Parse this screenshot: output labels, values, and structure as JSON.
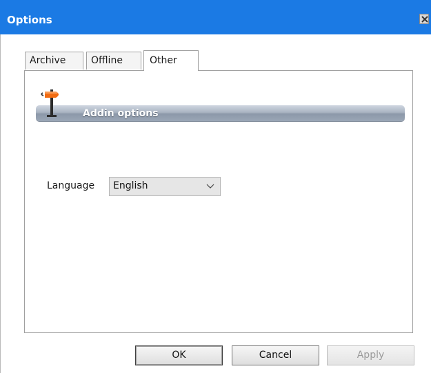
{
  "window": {
    "title": "Options"
  },
  "tabs": [
    {
      "label": "Archive"
    },
    {
      "label": "Offline"
    },
    {
      "label": "Other"
    }
  ],
  "active_tab": "Other",
  "section": {
    "title": "Addin options",
    "icon": "signpost-icon"
  },
  "language": {
    "label": "Language",
    "value": "English"
  },
  "buttons": {
    "ok": "OK",
    "cancel": "Cancel",
    "apply": "Apply",
    "apply_enabled": false
  },
  "colors": {
    "titlebar": "#1b7ae4",
    "section_bar": "#9aa6b6",
    "signpost": "#f26c12"
  }
}
